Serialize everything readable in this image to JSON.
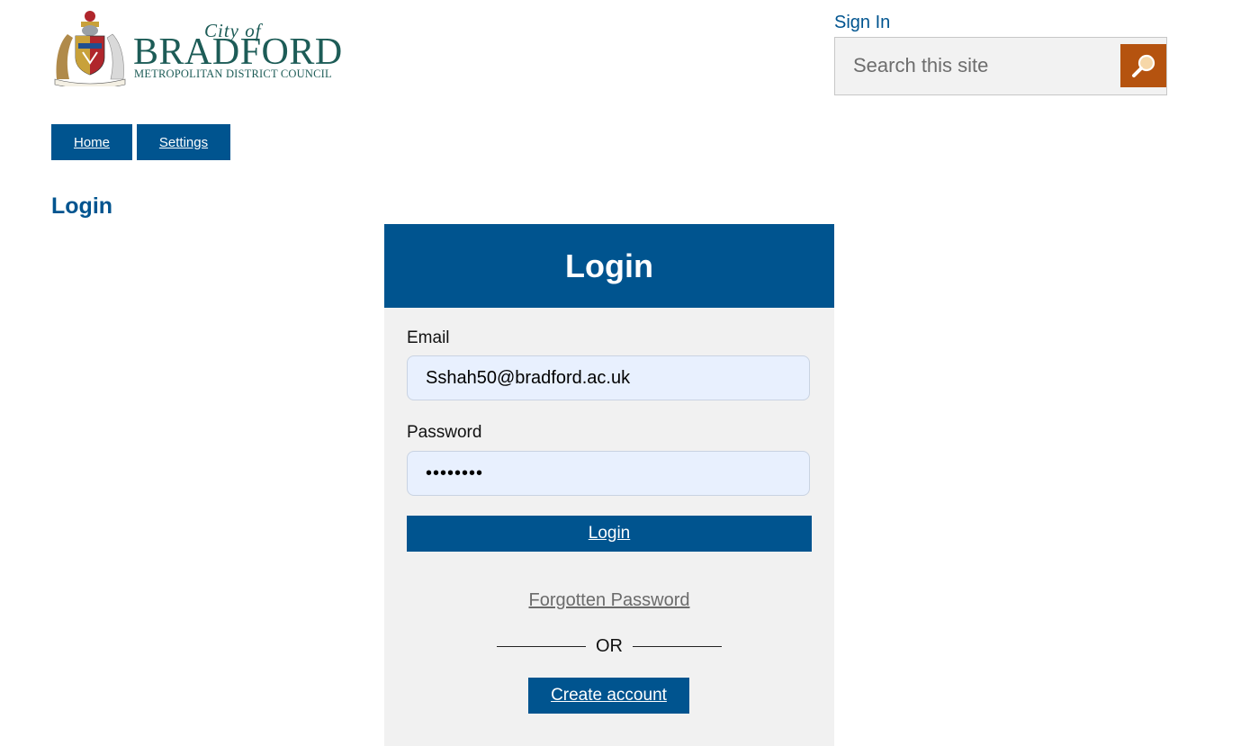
{
  "header": {
    "logo": {
      "icon": "bradford-coat-of-arms-icon",
      "line1": "City of",
      "line2": "BRADFORD",
      "line3": "METROPOLITAN DISTRICT COUNCIL"
    },
    "sign_in": "Sign In",
    "search": {
      "placeholder": "Search this site",
      "value": "",
      "button_icon": "magnifier-icon"
    }
  },
  "nav": {
    "items": [
      {
        "label": "Home"
      },
      {
        "label": "Settings"
      }
    ]
  },
  "page_title": "Login",
  "login_panel": {
    "title": "Login",
    "email_label": "Email",
    "email_value": "Sshah50@bradford.ac.uk",
    "password_label": "Password",
    "password_value": "••••••••",
    "submit_label": "Login",
    "forgot_label": "Forgotten Password",
    "or_label": "OR",
    "create_label": "Create account"
  },
  "colors": {
    "primary": "#00548f",
    "search_button": "#b5530f",
    "logo_text": "#1d5c57",
    "panel_bg": "#f1f1f1",
    "input_bg": "#e8f0fe"
  }
}
